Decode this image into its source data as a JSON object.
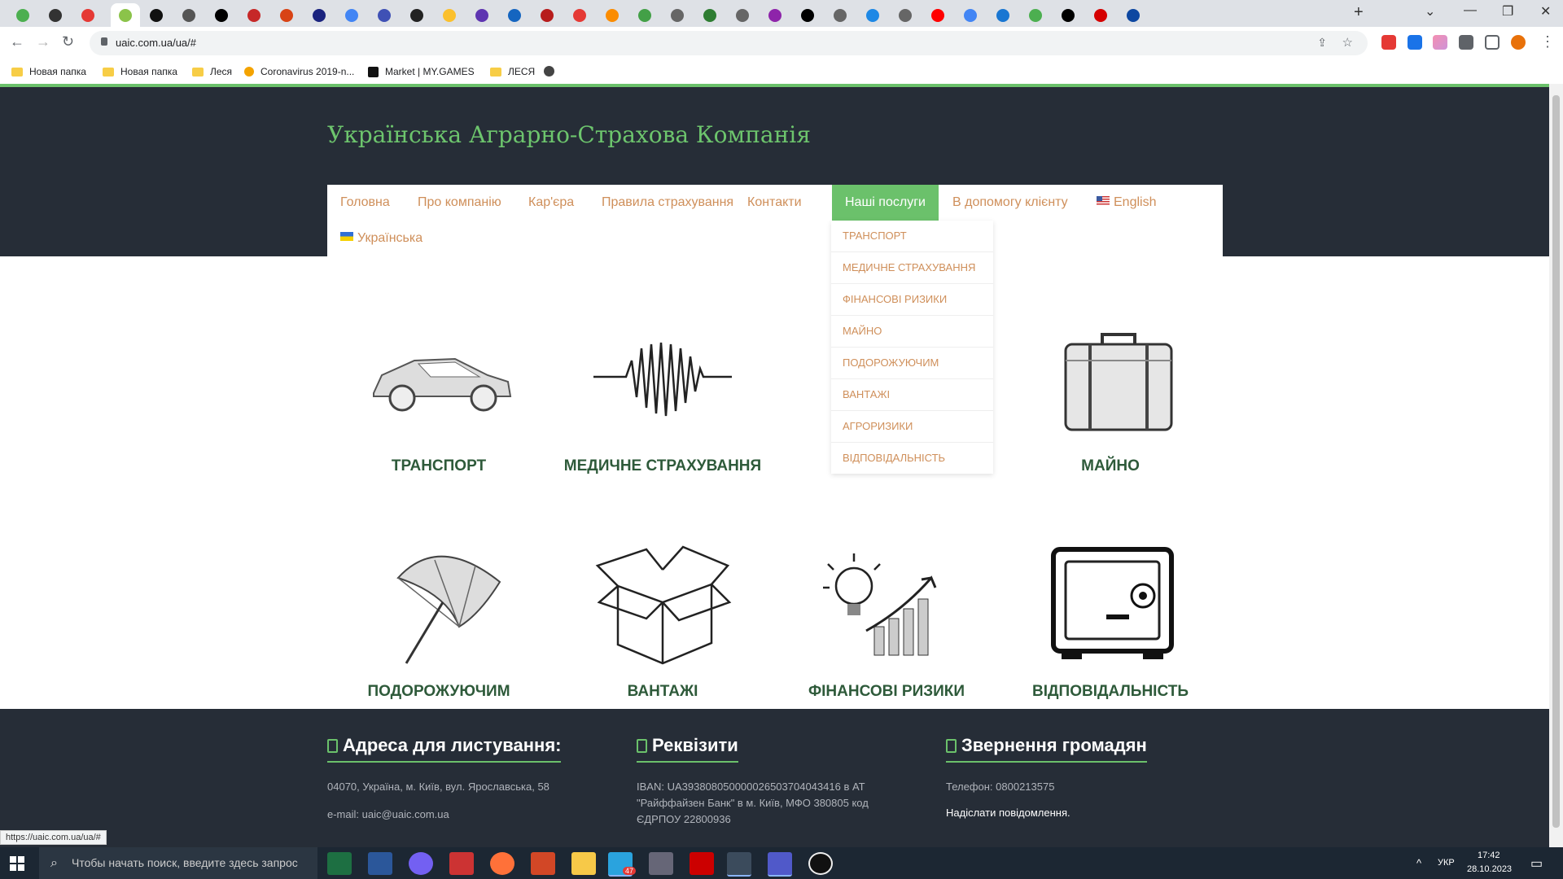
{
  "browser": {
    "url": "uaic.com.ua/ua/#",
    "status_url": "https://uaic.com.ua/ua/#",
    "bookmarks": [
      {
        "label": "Новая папка",
        "icon": "folder-icon"
      },
      {
        "label": "Новая папка",
        "icon": "folder-icon"
      },
      {
        "label": "Леся",
        "icon": "folder-icon"
      },
      {
        "label": "Coronavirus 2019-n...",
        "icon": "site-icon"
      },
      {
        "label": "Market | MY.GAMES",
        "icon": "site-icon"
      },
      {
        "label": "ЛЕСЯ",
        "icon": "folder-icon"
      }
    ]
  },
  "site": {
    "title": "Українська Аграрно-Страхова Компанія",
    "accent": "#6bc16b",
    "nav": {
      "home": "Головна",
      "about": "Про компанію",
      "career": "Кар'єра",
      "rules": "Правила страхування",
      "contacts": "Контакти",
      "services": "Наші послуги",
      "help": "В допомогу клієнту",
      "english": "English",
      "ukrainian": "Українська"
    },
    "dropdown": [
      "ТРАНСПОРТ",
      "МЕДИЧНЕ СТРАХУВАННЯ",
      "ФІНАНСОВІ РИЗИКИ",
      "МАЙНО",
      "ПОДОРОЖУЮЧИМ",
      "ВАНТАЖІ",
      "АГРОРИЗИКИ",
      "ВІДПОВІДАЛЬНІСТЬ"
    ],
    "services": [
      {
        "label": "ТРАНСПОРТ",
        "icon": "car-icon"
      },
      {
        "label": "МЕДИЧНЕ СТРАХУВАННЯ",
        "icon": "heartbeat-icon"
      },
      {
        "label": "",
        "icon": "wheat-icon"
      },
      {
        "label": "МАЙНО",
        "icon": "suitcase-icon"
      },
      {
        "label": "ПОДОРОЖУЮЧИМ",
        "icon": "umbrella-icon"
      },
      {
        "label": "ВАНТАЖІ",
        "icon": "box-icon"
      },
      {
        "label": "ФІНАНСОВІ РИЗИКИ",
        "icon": "lightbulb-chart-icon"
      },
      {
        "label": "ВІДПОВІДАЛЬНІСТЬ",
        "icon": "safe-icon"
      }
    ],
    "footer": {
      "address": {
        "title": "Адреса для листування:",
        "line1": "04070, Україна, м. Київ, вул. Ярославська, 58",
        "line2": "e-mail: uaic@uaic.com.ua"
      },
      "requisites": {
        "title": "Реквізити",
        "text": "IBAN: UA393808050000026503704043416 в АТ \"Райффайзен Банк\" в м. Київ, МФО 380805 код ЄДРПОУ 22800936"
      },
      "appeals": {
        "title": "Звернення громадян",
        "phone": "Телефон: 0800213575",
        "link": "Надіслати повідомлення."
      }
    }
  },
  "taskbar": {
    "search_placeholder": "Чтобы начать поиск, введите здесь запрос",
    "lang": "УКР",
    "time": "17:42",
    "date": "28.10.2023",
    "telegram_badge": "47"
  }
}
